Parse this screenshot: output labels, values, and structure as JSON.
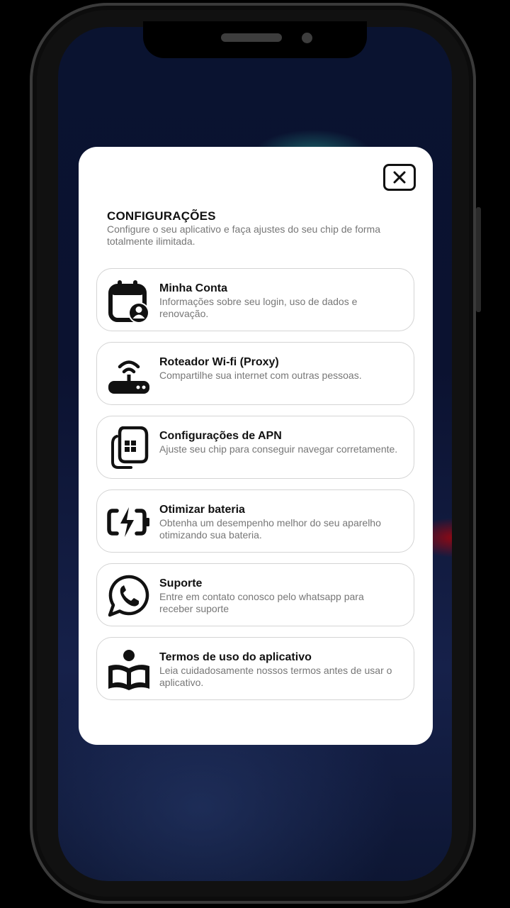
{
  "settings": {
    "title": "CONFIGURAÇÕES",
    "subtitle": "Configure o seu aplicativo e faça ajustes do seu chip de forma totalmente ilimitada.",
    "items": [
      {
        "title": "Minha Conta",
        "description": "Informações sobre seu login, uso de dados e renovação.",
        "icon": "calendar-user-icon"
      },
      {
        "title": "Roteador Wi-fi (Proxy)",
        "description": "Compartilhe sua internet com outras pessoas.",
        "icon": "wifi-router-icon"
      },
      {
        "title": "Configurações de APN",
        "description": "Ajuste seu chip para conseguir navegar corretamente.",
        "icon": "sim-card-icon"
      },
      {
        "title": "Otimizar bateria",
        "description": "Obtenha um desempenho melhor do seu aparelho otimizando sua bateria.",
        "icon": "battery-charging-icon"
      },
      {
        "title": "Suporte",
        "description": "Entre em contato conosco pelo whatsapp para receber suporte",
        "icon": "whatsapp-icon"
      },
      {
        "title": "Termos de uso do aplicativo",
        "description": "Leia cuidadosamente nossos termos antes de usar o aplicativo.",
        "icon": "reading-book-icon"
      }
    ]
  },
  "colors": {
    "modal_bg": "#ffffff",
    "title": "#111111",
    "muted": "#777777",
    "border": "#d4d4d4"
  }
}
